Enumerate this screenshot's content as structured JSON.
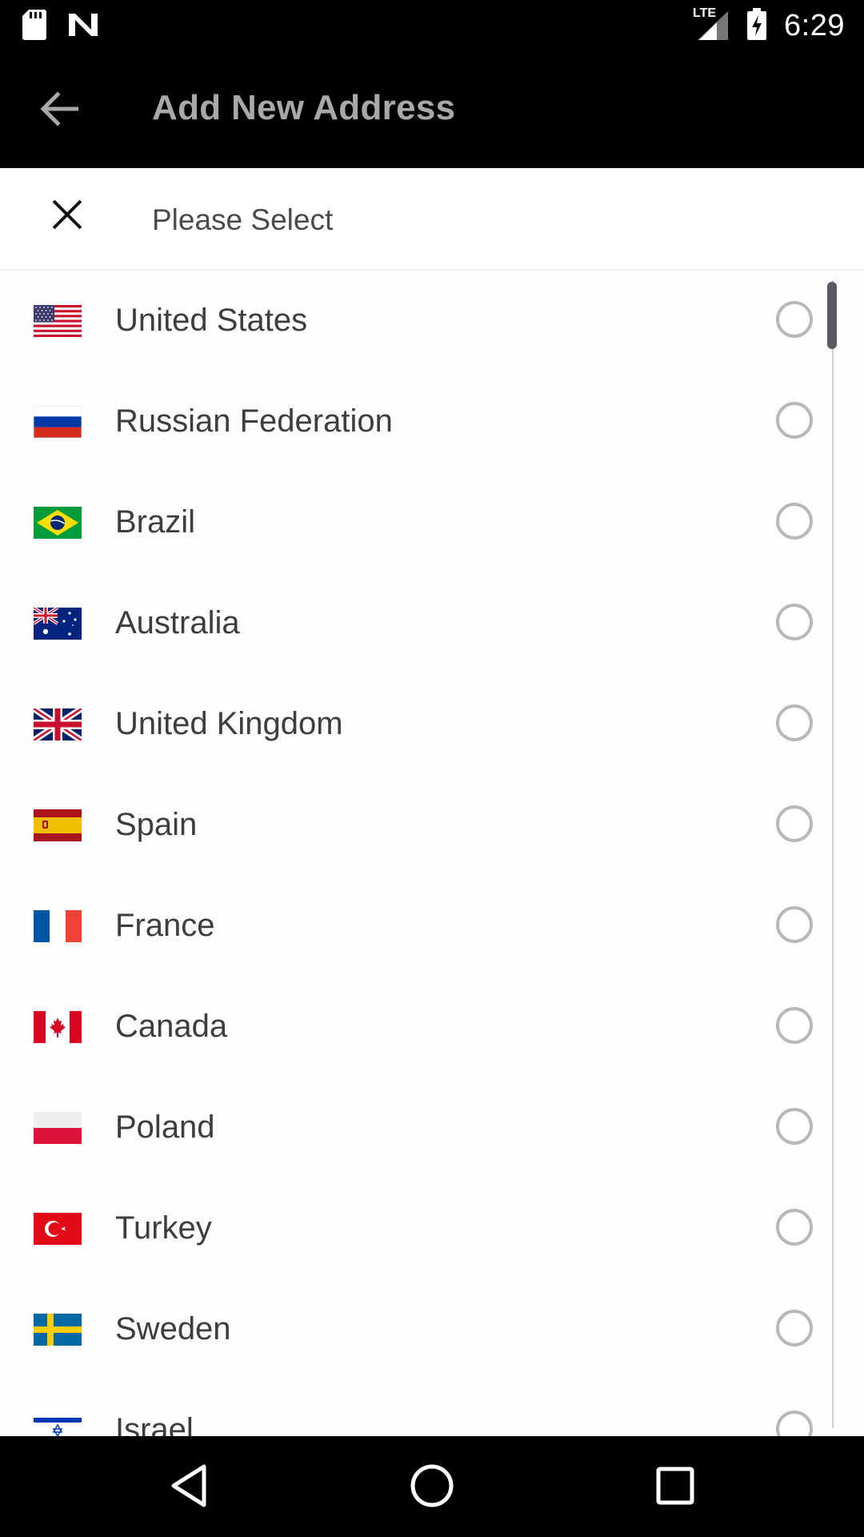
{
  "status_bar": {
    "time": "6:29",
    "network_label": "LTE",
    "icons": [
      "sd-card-icon",
      "n-app-icon",
      "lte-signal-icon",
      "battery-charging-icon"
    ]
  },
  "app_bar": {
    "title": "Add New Address",
    "back_icon": "arrow-left-icon"
  },
  "sheet": {
    "title": "Please Select",
    "close_icon": "close-icon"
  },
  "countries": [
    {
      "name": "United States",
      "flag": "us-flag-icon",
      "selected": false
    },
    {
      "name": "Russian Federation",
      "flag": "russia-flag-icon",
      "selected": false
    },
    {
      "name": "Brazil",
      "flag": "brazil-flag-icon",
      "selected": false
    },
    {
      "name": "Australia",
      "flag": "australia-flag-icon",
      "selected": false
    },
    {
      "name": "United Kingdom",
      "flag": "uk-flag-icon",
      "selected": false
    },
    {
      "name": "Spain",
      "flag": "spain-flag-icon",
      "selected": false
    },
    {
      "name": "France",
      "flag": "france-flag-icon",
      "selected": false
    },
    {
      "name": "Canada",
      "flag": "canada-flag-icon",
      "selected": false
    },
    {
      "name": "Poland",
      "flag": "poland-flag-icon",
      "selected": false
    },
    {
      "name": "Turkey",
      "flag": "turkey-flag-icon",
      "selected": false
    },
    {
      "name": "Sweden",
      "flag": "sweden-flag-icon",
      "selected": false
    },
    {
      "name": "Israel",
      "flag": "israel-flag-icon",
      "selected": false
    }
  ],
  "nav_bar": {
    "icons": [
      "back-triangle-icon",
      "home-circle-icon",
      "recents-square-icon"
    ]
  },
  "colors": {
    "app_bar_bg": "#000000",
    "title_text": "#a8a8a8",
    "list_text": "#3d3d3d",
    "radio_border": "#b8b8b8",
    "background": "#fdfdfd"
  }
}
